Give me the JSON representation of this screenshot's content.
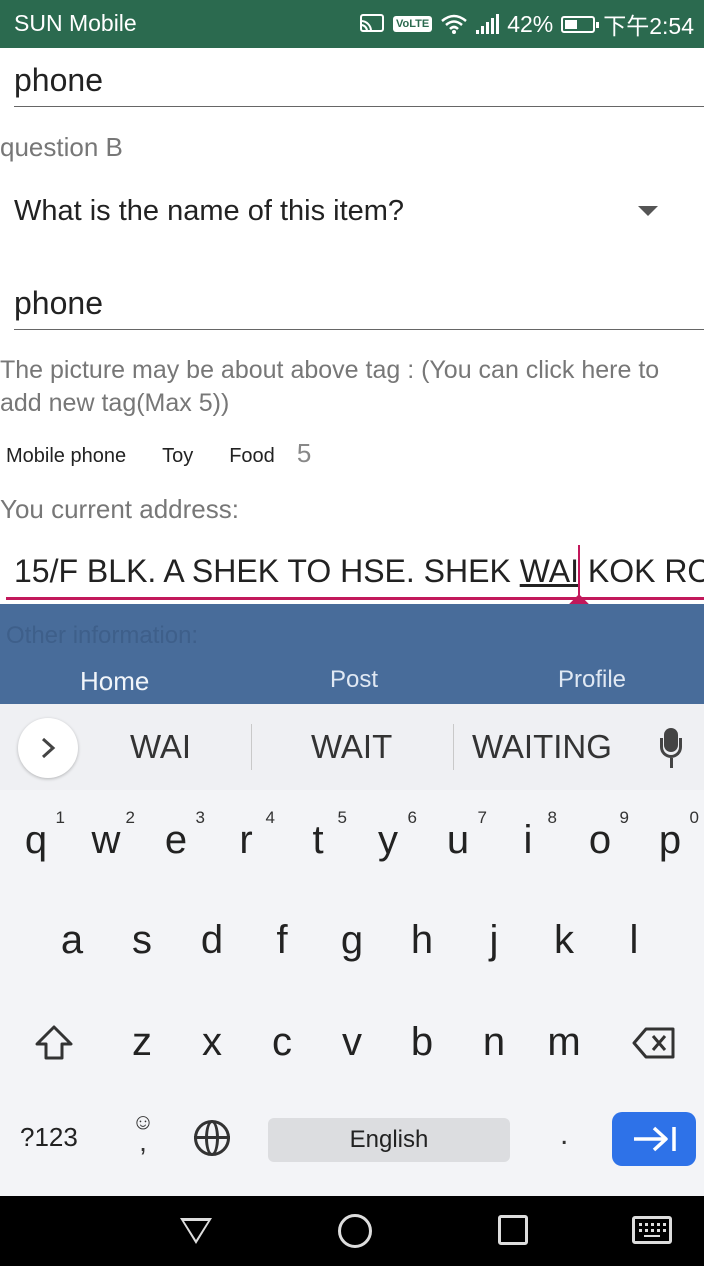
{
  "status_bar": {
    "carrier": "SUN Mobile",
    "volte": "VoLTE",
    "battery_pct": "42%",
    "time": "下午2:54"
  },
  "form": {
    "field1_value": "phone",
    "question_label": "question B",
    "spinner_value": "What is the name of this item?",
    "field2_value": "phone",
    "tag_hint": "The picture may be about above tag : (You can click here to add new tag(Max 5))",
    "tags": [
      "Mobile phone",
      "Toy",
      "Food"
    ],
    "tag_count": "5",
    "address_label": "You current address:",
    "address_before": "15/F BLK. A SHEK TO HSE. SHEK ",
    "address_word": "WAI",
    "address_after": " KOK ROAD"
  },
  "bottom_nav": {
    "other_label": "Other information:",
    "home": "Home",
    "post": "Post",
    "profile": "Profile"
  },
  "keyboard": {
    "suggestions": [
      "WAI",
      "WAIT",
      "WAITING"
    ],
    "row1": [
      {
        "k": "q",
        "n": "1"
      },
      {
        "k": "w",
        "n": "2"
      },
      {
        "k": "e",
        "n": "3"
      },
      {
        "k": "r",
        "n": "4"
      },
      {
        "k": "t",
        "n": "5"
      },
      {
        "k": "y",
        "n": "6"
      },
      {
        "k": "u",
        "n": "7"
      },
      {
        "k": "i",
        "n": "8"
      },
      {
        "k": "o",
        "n": "9"
      },
      {
        "k": "p",
        "n": "0"
      }
    ],
    "row2": [
      "a",
      "s",
      "d",
      "f",
      "g",
      "h",
      "j",
      "k",
      "l"
    ],
    "row3": [
      "z",
      "x",
      "c",
      "v",
      "b",
      "n",
      "m"
    ],
    "symbols_label": "?123",
    "emoji_top": "☺",
    "emoji_bottom": ",",
    "space_label": "English",
    "period": "."
  },
  "icons": {
    "cast": "cast-icon",
    "wifi": "wifi-icon",
    "signal": "signal-icon",
    "battery": "battery-icon",
    "dropdown": "dropdown-arrow-icon",
    "mic": "microphone-icon",
    "shift": "shift-icon",
    "backspace": "backspace-icon",
    "globe": "globe-icon",
    "enter": "tab-enter-icon",
    "back": "back-icon",
    "home": "home-icon",
    "recents": "recents-icon",
    "keyboard": "keyboard-icon"
  },
  "colors": {
    "status_bar": "#2b6a4f",
    "nav_overlay": "#486c9a",
    "accent": "#c2185b",
    "enter_key": "#2e72e8"
  }
}
